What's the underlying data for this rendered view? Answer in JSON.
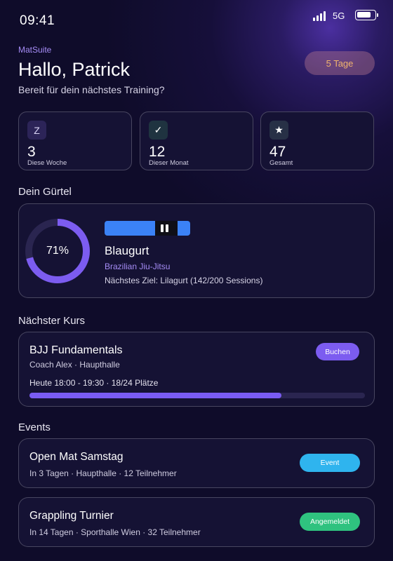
{
  "status": {
    "time": "09:41",
    "network": "5G"
  },
  "header": {
    "brand": "MatSuite",
    "greeting": "Hallo, Patrick",
    "subtitle": "Bereit für dein nächstes Training?",
    "streak": "5 Tage"
  },
  "stats": [
    {
      "icon": "Z",
      "icon_name": "sleep-icon",
      "value": "3",
      "label": "Diese Woche",
      "icon_bg": "#2c2458",
      "icon_color": "#d9d4f5"
    },
    {
      "icon": "✓",
      "icon_name": "check-icon",
      "value": "12",
      "label": "Dieser Monat",
      "icon_bg": "#1f3340",
      "icon_color": "#ffffff"
    },
    {
      "icon": "★",
      "icon_name": "star-icon",
      "value": "47",
      "label": "Gesamt",
      "icon_bg": "#273046",
      "icon_color": "#ffffff"
    }
  ],
  "belt_section": {
    "title": "Dein Gürtel"
  },
  "belt": {
    "progress_label": "71%",
    "progress": 0.71,
    "name": "Blaugurt",
    "art": "Brazilian Jiu-Jitsu",
    "goal": "Nächstes Ziel: Lilagurt (142/200 Sessions)",
    "color": "#3b82f6"
  },
  "course_section": {
    "title": "Nächster Kurs"
  },
  "course": {
    "title": "BJJ Fundamentals",
    "meta": "Coach Alex · Haupthalle",
    "time": "Heute 18:00 - 19:30 · 18/24 Plätze",
    "button": "Buchen",
    "capacity_fill": 0.75
  },
  "events_section": {
    "title": "Events"
  },
  "events": [
    {
      "title": "Open Mat Samstag",
      "meta": "In 3 Tagen · Haupthalle · 12 Teilnehmer",
      "button": "Event",
      "color": "#2fb4ee"
    },
    {
      "title": "Grappling Turnier",
      "meta": "In 14 Tagen · Sporthalle Wien · 32 Teilnehmer",
      "button": "Angemeldet",
      "color": "#2fc27f"
    }
  ],
  "colors": {
    "accent": "#7c5cf0",
    "streak": "#f0b36e",
    "ring_track": "#2a2550"
  }
}
